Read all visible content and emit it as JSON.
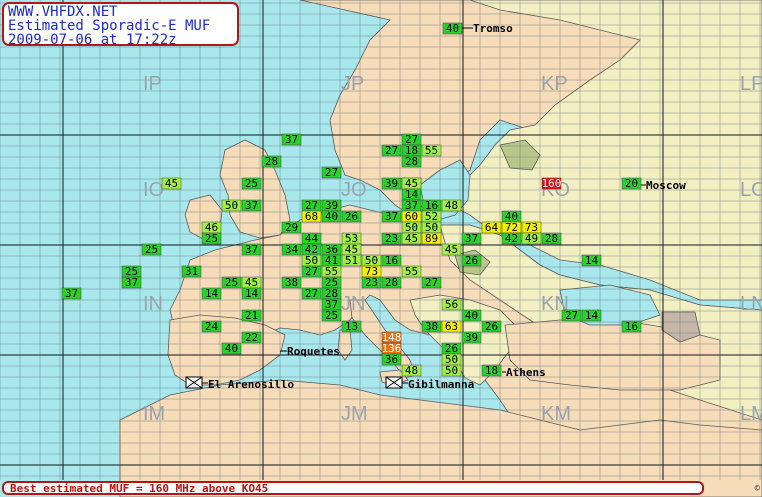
{
  "header": {
    "site": "WWW.VHFDX.NET",
    "title": "Estimated Sporadic-E MUF",
    "timestamp": "2009-07-06 at 17:22z"
  },
  "status": {
    "best_muf": "Best estimated MUF = 160 MHz above KO45",
    "copyright": "©"
  },
  "colors": {
    "sea": "#a8e8ec",
    "land_west": "#f6dcb8",
    "land_east": "#f2efc2",
    "land_green": "#cfe6b0",
    "grid": "#1a2b3a",
    "grid_fine": "#5a6a78",
    "muf_low": "#2bd12b",
    "muf_mid": "#9ff042",
    "muf_high": "#f2f200",
    "muf_top": "#f07010",
    "muf_max": "#e01010"
  },
  "grid_fields": [
    "IP",
    "JP",
    "KP",
    "LP",
    "IO",
    "JO",
    "KO",
    "LO",
    "IN",
    "JN",
    "KN",
    "LN",
    "IM",
    "JM",
    "KM",
    "LM"
  ],
  "cities": [
    "Tromso",
    "Moscow",
    "Roquetes",
    "El Arenosillo",
    "Gibilmanna",
    "Athens"
  ],
  "muf_reports": [
    {
      "v": "40"
    },
    {
      "v": "37"
    },
    {
      "v": "27"
    },
    {
      "v": "27"
    },
    {
      "v": "18"
    },
    {
      "v": "55"
    },
    {
      "v": "28"
    },
    {
      "v": "28"
    },
    {
      "v": "27"
    },
    {
      "v": "45"
    },
    {
      "v": "25"
    },
    {
      "v": "37"
    },
    {
      "v": "39"
    },
    {
      "v": "45"
    },
    {
      "v": "160"
    },
    {
      "v": "20"
    },
    {
      "v": "50"
    },
    {
      "v": "37"
    },
    {
      "v": "27"
    },
    {
      "v": "39"
    },
    {
      "v": "14"
    },
    {
      "v": "37"
    },
    {
      "v": "16"
    },
    {
      "v": "48"
    },
    {
      "v": "68"
    },
    {
      "v": "40"
    },
    {
      "v": "26"
    },
    {
      "v": "37"
    },
    {
      "v": "60"
    },
    {
      "v": "52"
    },
    {
      "v": "40"
    },
    {
      "v": "46"
    },
    {
      "v": "29"
    },
    {
      "v": "50"
    },
    {
      "v": "50"
    },
    {
      "v": "64"
    },
    {
      "v": "72"
    },
    {
      "v": "73"
    },
    {
      "v": "25"
    },
    {
      "v": "44"
    },
    {
      "v": "53"
    },
    {
      "v": "23"
    },
    {
      "v": "45"
    },
    {
      "v": "89"
    },
    {
      "v": "37"
    },
    {
      "v": "42"
    },
    {
      "v": "49"
    },
    {
      "v": "28"
    },
    {
      "v": "25"
    },
    {
      "v": "37"
    },
    {
      "v": "34"
    },
    {
      "v": "42"
    },
    {
      "v": "36"
    },
    {
      "v": "45"
    },
    {
      "v": "45"
    },
    {
      "v": "50"
    },
    {
      "v": "41"
    },
    {
      "v": "51"
    },
    {
      "v": "50"
    },
    {
      "v": "16"
    },
    {
      "v": "26"
    },
    {
      "v": "14"
    },
    {
      "v": "25"
    },
    {
      "v": "31"
    },
    {
      "v": "27"
    },
    {
      "v": "55"
    },
    {
      "v": "73"
    },
    {
      "v": "55"
    },
    {
      "v": "37"
    },
    {
      "v": "25"
    },
    {
      "v": "45"
    },
    {
      "v": "38"
    },
    {
      "v": "25"
    },
    {
      "v": "23"
    },
    {
      "v": "28"
    },
    {
      "v": "27"
    },
    {
      "v": "37"
    },
    {
      "v": "14"
    },
    {
      "v": "14"
    },
    {
      "v": "27"
    },
    {
      "v": "28"
    },
    {
      "v": "56"
    },
    {
      "v": "37"
    },
    {
      "v": "21"
    },
    {
      "v": "25"
    },
    {
      "v": "40"
    },
    {
      "v": "27"
    },
    {
      "v": "14"
    },
    {
      "v": "24"
    },
    {
      "v": "13"
    },
    {
      "v": "38"
    },
    {
      "v": "63"
    },
    {
      "v": "26"
    },
    {
      "v": "16"
    },
    {
      "v": "22"
    },
    {
      "v": "148"
    },
    {
      "v": "39"
    },
    {
      "v": "40"
    },
    {
      "v": "26"
    },
    {
      "v": "136"
    },
    {
      "v": "50"
    },
    {
      "v": "36"
    },
    {
      "v": "50"
    },
    {
      "v": "18"
    },
    {
      "v": "48"
    }
  ]
}
